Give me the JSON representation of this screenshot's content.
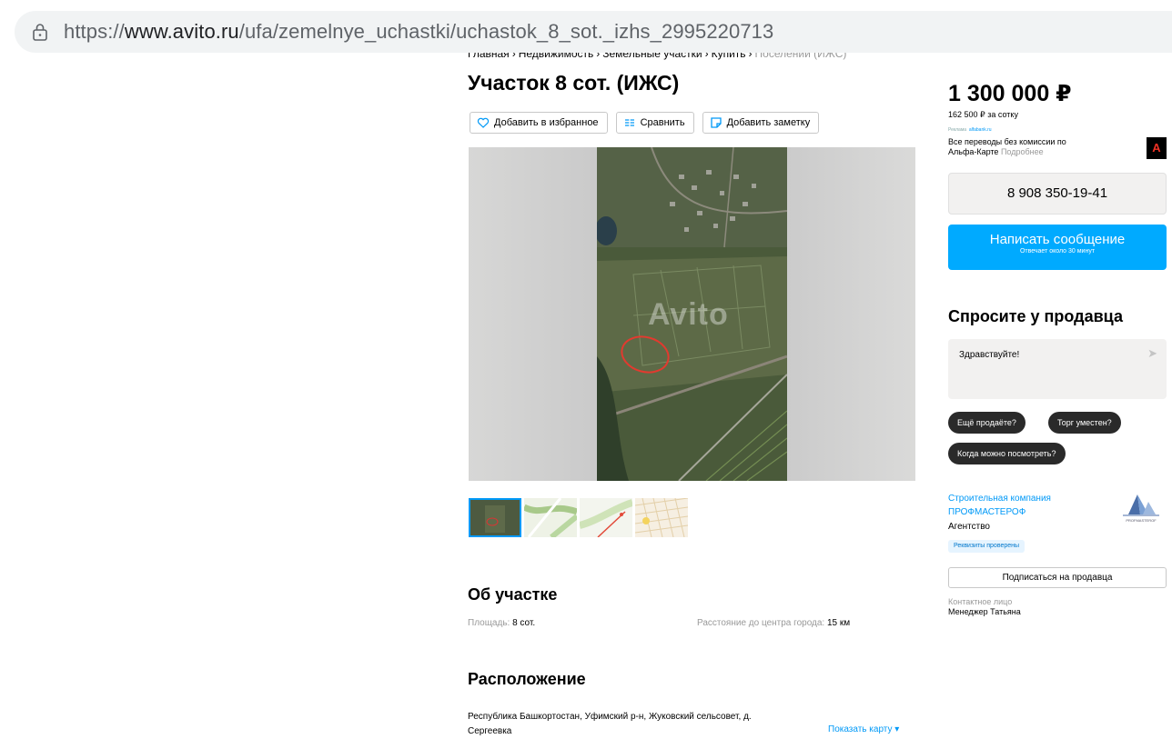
{
  "browser": {
    "url_scheme": "https://",
    "url_host": "www.avito.ru",
    "url_path": "/ufa/zemelnye_uchastki/uchastok_8_sot._izhs_2995220713"
  },
  "breadcrumbs": [
    "Главная",
    "Недвижимость",
    "Земельные участки",
    "Купить",
    "Поселений (ИЖС)"
  ],
  "listing": {
    "title": "Участок 8 сот. (ИЖС)",
    "actions": {
      "favorite": "Добавить в избранное",
      "compare": "Сравнить",
      "note": "Добавить заметку"
    },
    "watermark": "Avito",
    "about": {
      "title": "Об участке",
      "area_label": "Площадь:",
      "area_value": "8 сот.",
      "distance_label": "Расстояние до центра города:",
      "distance_value": "15 км"
    },
    "location": {
      "title": "Расположение",
      "address_line1": "Республика Башкортостан, Уфимский р-н, Жуковский сельсовет, д.",
      "address_line2": "Сергеевка",
      "show_map": "Показать карту ▾"
    }
  },
  "sidebar": {
    "price": "1 300 000 ₽",
    "price_per": "162 500 ₽ за сотку",
    "ad_label": "Реклама",
    "ad_domain": "alfabank.ru",
    "ad_text": "Все переводы без комиссии по Альфа-Карте",
    "ad_more": "Подробнее",
    "ad_logo_letter": "А",
    "phone": "8 908 350-19-41",
    "message_button": "Написать сообщение",
    "message_sub": "Отвечает около 30 минут",
    "ask_title": "Спросите у продавца",
    "ask_placeholder": "Здравствуйте!",
    "quick_questions": [
      "Ещё продаёте?",
      "Торг уместен?",
      "Когда можно посмотреть?"
    ],
    "seller_name": "Строительная компания ПРОФМАСТЕРОФ",
    "seller_type": "Агентство",
    "verified": "Реквизиты проверены",
    "logo_caption": "PROFMASTEROF",
    "subscribe": "Подписаться на продавца",
    "contact_label": "Контактное лицо",
    "contact_name": "Менеджер Татьяна"
  },
  "colors": {
    "accent": "#00aaff",
    "link": "#0099f7",
    "chip": "#2a2a2a"
  }
}
